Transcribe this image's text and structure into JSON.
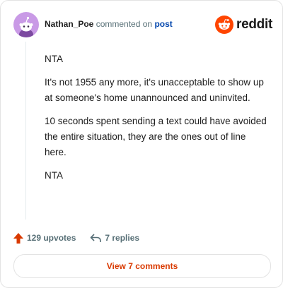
{
  "header": {
    "username": "Nathan_Poe",
    "action_text": "commented on",
    "target_link": "post",
    "brand_word": "reddit"
  },
  "comment": {
    "paragraphs": [
      "NTA",
      "It's not 1955 any more, it's unacceptable to show up at someone's home unannounced and uninvited.",
      "10 seconds spent sending a text could have avoided the entire situation, they are the ones out of line here.",
      "NTA"
    ]
  },
  "actions": {
    "upvotes_label": "129 upvotes",
    "replies_label": "7 replies"
  },
  "footer": {
    "view_comments_label": "View 7 comments"
  },
  "colors": {
    "brand_orange": "#ff4500",
    "upvote_orange": "#d93900",
    "link_blue": "#0045ac",
    "avatar_purple": "#c99ae6"
  },
  "icons": [
    "snoo-avatar-icon",
    "reddit-logo-icon",
    "upvote-arrow-icon",
    "reply-arrow-icon"
  ]
}
